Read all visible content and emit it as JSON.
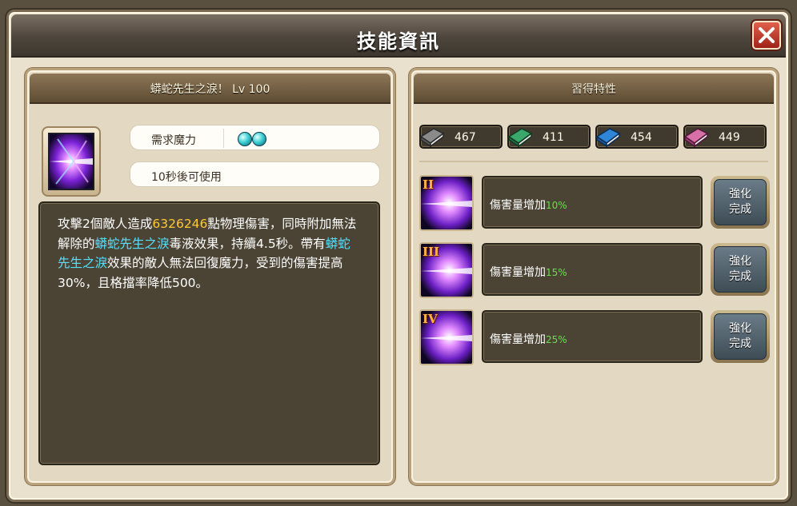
{
  "window": {
    "title": "技能資訊",
    "close_icon": "close-x-icon"
  },
  "skill": {
    "header": "蟒蛇先生之淚！ Lv 100",
    "icon": "purple-burst-skill-icon",
    "mp_label": "需求魔力",
    "mp_orbs": 2,
    "cooldown_label": "10秒後可使用",
    "description": {
      "p1": "攻擊2個敵人造成",
      "damage": "6326246",
      "p2": "點物理傷害，同時附加無法解除的",
      "effect1": "蟒蛇先生之淚",
      "p3": "毒液效果，持續4.5秒。帶有",
      "effect2": "蟒蛇先生之淚",
      "p4": "效果的敵人無法回復魔力，受到的傷害提高30%，且格擋率降低500。"
    }
  },
  "traits_panel": {
    "header": "習得特性",
    "stats": [
      {
        "icon": "gray-book-icon",
        "value": "467",
        "color": "#8a8a8a"
      },
      {
        "icon": "green-book-icon",
        "value": "411",
        "color": "#3aa86a"
      },
      {
        "icon": "blue-book-icon",
        "value": "454",
        "color": "#2f86d8"
      },
      {
        "icon": "pink-book-icon",
        "value": "449",
        "color": "#d870a8"
      }
    ],
    "traits": [
      {
        "tier": "II",
        "text": "傷害量增加",
        "percent": "10%",
        "button": "強化完成"
      },
      {
        "tier": "III",
        "text": "傷害量增加",
        "percent": "15%",
        "button": "強化完成"
      },
      {
        "tier": "IV",
        "text": "傷害量增加",
        "percent": "25%",
        "button": "強化完成"
      }
    ]
  }
}
